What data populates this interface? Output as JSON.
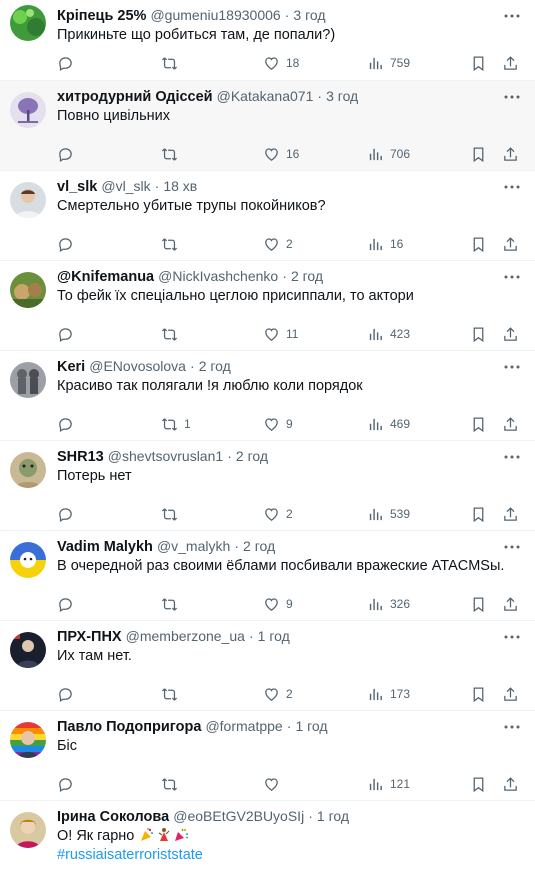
{
  "tweets": [
    {
      "name": "Кріпець 25%",
      "handle": "@gumeniu18930006",
      "time": "3 год",
      "text": "Прикиньте що робиться там, де попали?)",
      "replies": "",
      "retweets": "",
      "likes": "18",
      "views": "759"
    },
    {
      "name": "хитродурний Одіссей",
      "handle": "@Katakana071",
      "time": "3 год",
      "text": "Повно цивільних",
      "replies": "",
      "retweets": "",
      "likes": "16",
      "views": "706"
    },
    {
      "name": "vl_slk",
      "handle": "@vl_slk",
      "time": "18 хв",
      "text": "Смертельно убитые трупы покойников?",
      "replies": "",
      "retweets": "",
      "likes": "2",
      "views": "16"
    },
    {
      "name": "@Knifemanua",
      "handle": "@NickIvashchenko",
      "time": "2 год",
      "text": "То фейк їх спеціально цеглою присиппали, то актори",
      "replies": "",
      "retweets": "",
      "likes": "11",
      "views": "423"
    },
    {
      "name": "Keri",
      "handle": "@ENovosolova",
      "time": "2 год",
      "text": "Красиво так полягали !я люблю коли порядок",
      "replies": "",
      "retweets": "1",
      "likes": "9",
      "views": "469"
    },
    {
      "name": "SHR13",
      "handle": "@shevtsovruslan1",
      "time": "2 год",
      "text": "Потерь нет",
      "replies": "",
      "retweets": "",
      "likes": "2",
      "views": "539"
    },
    {
      "name": "Vadim Malykh",
      "handle": "@v_malykh",
      "time": "2 год",
      "text": "В очередной раз своими ёблами посбивали вражеские ATACMSы.",
      "replies": "",
      "retweets": "",
      "likes": "9",
      "views": "326"
    },
    {
      "name": "ПРХ-ПНХ",
      "handle": "@memberzone_ua",
      "time": "1 год",
      "text": "Их там нет.",
      "replies": "",
      "retweets": "",
      "likes": "2",
      "views": "173"
    },
    {
      "name": "Павло Подопригора",
      "handle": "@formatppe",
      "time": "1 год",
      "text": "Біс",
      "replies": "",
      "retweets": "",
      "likes": "",
      "views": "121"
    },
    {
      "name": "Ірина Соколова",
      "handle": "@eoBEtGV2BUyoSIj",
      "time": "1 год",
      "text": "О! Як гарно",
      "hashtag": "#russiaisaterroriststate"
    }
  ],
  "icons": {
    "more": "more-horizontal-icon",
    "reply": "reply-icon",
    "retweet": "retweet-icon",
    "like": "heart-icon",
    "views": "views-chart-icon",
    "bookmark": "bookmark-icon",
    "share": "share-icon"
  },
  "colors": {
    "text": "#0f1419",
    "secondary": "#536471",
    "link": "#1d9bf0",
    "divider": "#eff3f4",
    "hover_bg": "#f7f7f7"
  }
}
